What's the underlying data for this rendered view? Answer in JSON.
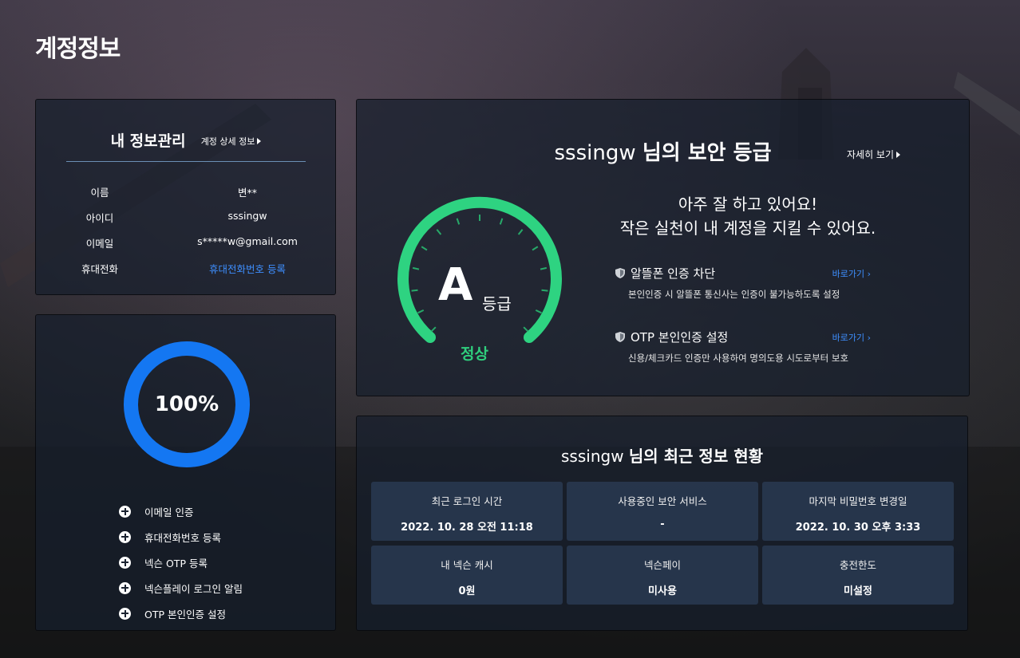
{
  "page": {
    "title": "계정정보"
  },
  "my_info": {
    "title": "내 정보관리",
    "detail_link": "계정 상세 정보",
    "rows": [
      {
        "label": "이름",
        "value": "변**"
      },
      {
        "label": "아이디",
        "value": "sssingw"
      },
      {
        "label": "이메일",
        "value": "s*****w@gmail.com"
      },
      {
        "label": "휴대전화",
        "value": "휴대전화번호 등록"
      }
    ]
  },
  "progress": {
    "percent_label": "100%",
    "percent": 100,
    "items": [
      {
        "label": "이메일 인증"
      },
      {
        "label": "휴대전화번호 등록"
      },
      {
        "label": "넥슨 OTP 등록"
      },
      {
        "label": "넥슨플레이 로그인 알림"
      },
      {
        "label": "OTP 본인인증 설정"
      }
    ]
  },
  "security": {
    "username": "sssingw",
    "title_suffix": "님의 보안 등급",
    "more_link": "자세히 보기",
    "grade": "A",
    "grade_unit": "등급",
    "status": "정상",
    "message_line1": "아주 잘 하고 있어요!",
    "message_line2": "작은 실천이 내 계정을 지킬 수 있어요.",
    "items": [
      {
        "title": "알뜰폰 인증 차단",
        "link": "바로가기",
        "desc": "본인인증 시 알뜰폰 통신사는 인증이 불가능하도록 설정"
      },
      {
        "title": "OTP 본인인증 설정",
        "link": "바로가기",
        "desc": "신용/체크카드 인증만 사용하여 명의도용 시도로부터 보호"
      }
    ],
    "colors": {
      "gauge": "#2fdc86",
      "status": "#2fcf7d",
      "link": "#3e8fff"
    }
  },
  "recent": {
    "username": "sssingw",
    "title_suffix": "님의 최근 정보 현황",
    "cells": [
      {
        "label": "최근 로그인 시간",
        "value": "2022. 10. 28 오전 11:18"
      },
      {
        "label": "사용중인 보안 서비스",
        "value": "-"
      },
      {
        "label": "마지막 비밀번호 변경일",
        "value": "2022. 10. 30 오후 3:33"
      },
      {
        "label": "내 넥슨 캐시",
        "value": "0원"
      },
      {
        "label": "넥슨페이",
        "value": "미사용"
      },
      {
        "label": "충전한도",
        "value": "미설정"
      }
    ]
  }
}
